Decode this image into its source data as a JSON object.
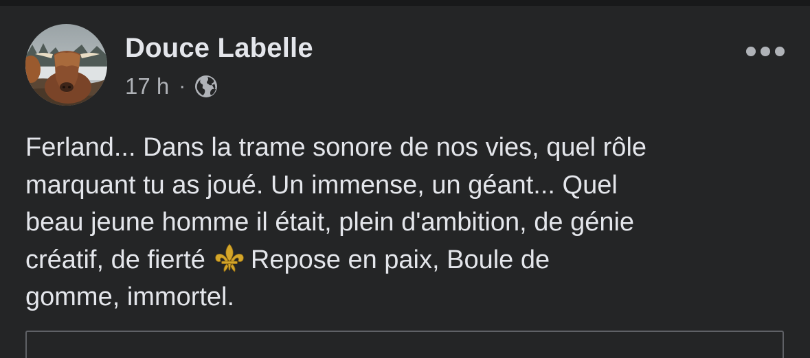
{
  "post": {
    "author": "Douce Labelle",
    "timestamp": "17 h",
    "separator": "·",
    "privacy_icon": "globe-icon",
    "more_icon": "more-options-icon",
    "avatar_icon": "profile-photo-highland-cow",
    "text_lines": [
      "Ferland... Dans la trame sonore de nos vies, quel rôle",
      "marquant tu as joué.  Un immense, un géant... Quel",
      "beau jeune homme il était, plein d'ambition, de génie",
      "créatif, de fierté",
      "Repose en paix, Boule de",
      "gomme, immortel."
    ],
    "emoji": "fleur-de-lis-icon"
  },
  "colors": {
    "background": "#242526",
    "top_bar": "#18191a",
    "primary_text": "#e4e6eb",
    "secondary_text": "#b0b3b8",
    "emoji_gold": "#d4a62a"
  }
}
